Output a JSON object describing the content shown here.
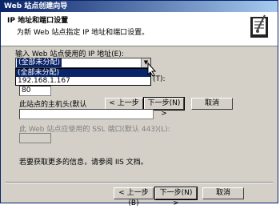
{
  "window": {
    "title": "Web 站点创建向导"
  },
  "header": {
    "title": "IP 地址和端口设置",
    "subtitle": "为新 Web 站点指定 IP 地址和端口设置。"
  },
  "form": {
    "ip_label": "输入 Web 站点使用的 IP 地址(E):",
    "ip_selected": "(全部未分配)",
    "ip_options": [
      "(全部未分配)",
      "192.168.1.167"
    ],
    "port_label_suffix": "(T):",
    "port_value": "80",
    "host_header_label": "此站点的主机头(默认",
    "host_header_value": "",
    "ssl_port_label": "此 Web 站点应使用的 SSL 端口(默认 443)(L):",
    "ssl_port_value": "",
    "help_text": "若要获取更多的信息，请参阅 IIS 文档。"
  },
  "overlay_buttons": {
    "back": "< 上一步(B)",
    "next": "下一步(N) >",
    "cancel": "取消"
  },
  "footer_buttons": {
    "back": "< 上一步(B)",
    "next": "下一步(N) >",
    "cancel": "取消"
  }
}
